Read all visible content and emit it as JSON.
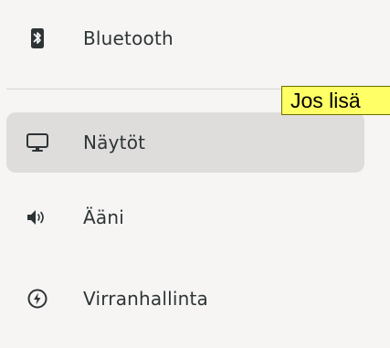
{
  "sidebar": {
    "items": [
      {
        "label": "Bluetooth",
        "icon": "bluetooth-icon",
        "selected": false
      },
      {
        "label": "Näytöt",
        "icon": "display-icon",
        "selected": true
      },
      {
        "label": "Ääni",
        "icon": "speaker-icon",
        "selected": false
      },
      {
        "label": "Virranhallinta",
        "icon": "power-icon",
        "selected": false
      }
    ]
  },
  "tooltip": {
    "text": "Jos lisä"
  },
  "colors": {
    "background": "#f6f5f4",
    "selected_background": "#dedddc",
    "text": "#2e3436",
    "tooltip_background": "#ffff66"
  }
}
